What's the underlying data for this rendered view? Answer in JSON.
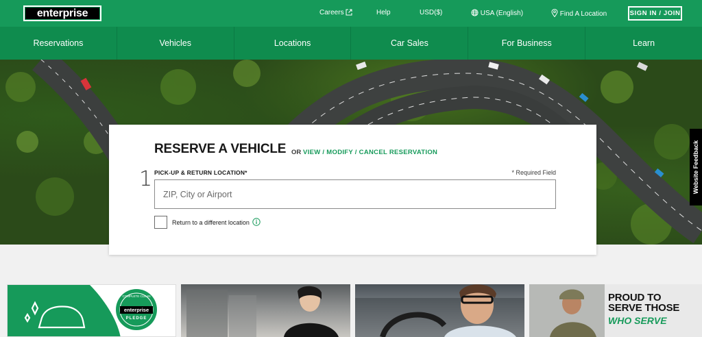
{
  "header": {
    "logo_text": "enterprise",
    "careers": "Careers",
    "help": "Help",
    "currency": "USD($)",
    "locale": "USA (English)",
    "find_location": "Find A Location",
    "signin": "SIGN IN / JOIN"
  },
  "nav": {
    "items": [
      "Reservations",
      "Vehicles",
      "Locations",
      "Car Sales",
      "For Business",
      "Learn"
    ]
  },
  "feedback": {
    "label": "Website Feedback"
  },
  "reservation": {
    "title": "RESERVE A VEHICLE",
    "or": "OR",
    "manage_link": "VIEW / MODIFY / CANCEL RESERVATION",
    "step": "1",
    "field_label": "PICK-UP & RETURN LOCATION*",
    "required_note": "* Required Field",
    "placeholder": "ZIP, City or Airport",
    "value": "",
    "different_return_label": "Return to a different location",
    "different_return_checked": false
  },
  "promos": {
    "tile1_badge_top": "COMPLETE CLEAN",
    "tile1_badge_brand": "enterprise",
    "tile1_badge_bottom": "PLEDGE",
    "tile4_headline_1": "PROUD TO",
    "tile4_headline_2": "SERVE THOSE",
    "tile4_subline": "WHO SERVE"
  },
  "colors": {
    "brand_green": "#169a5a",
    "nav_green": "#0f8c4e",
    "logo_black": "#000000"
  },
  "icons": [
    "external-link-icon",
    "globe-icon",
    "location-pin-icon",
    "info-icon",
    "clean-car-icon"
  ]
}
